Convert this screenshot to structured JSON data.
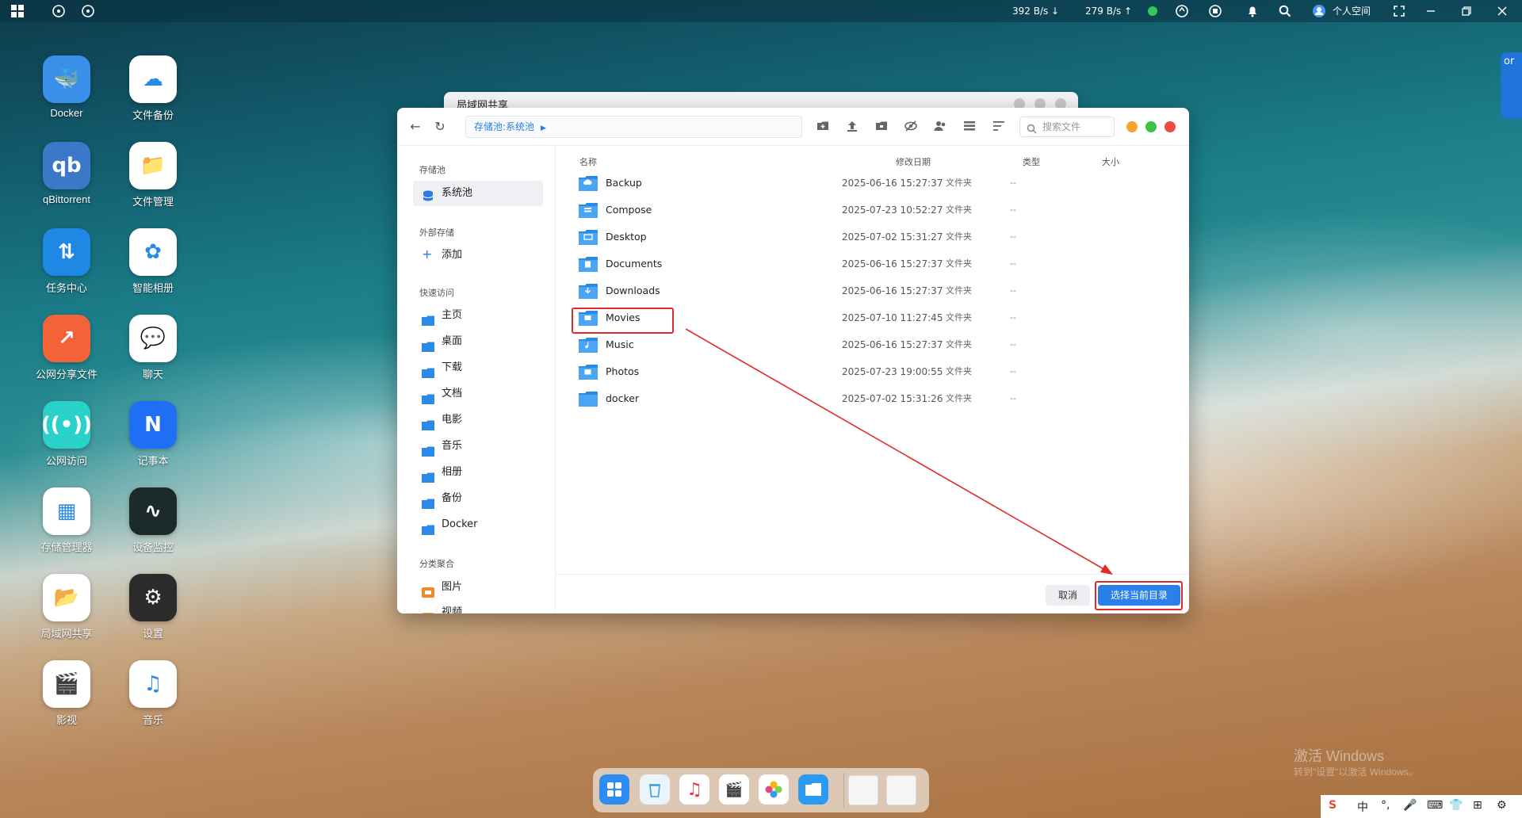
{
  "topbar": {
    "download_speed": "392 B/s ↓",
    "upload_speed": "279 B/s ↑",
    "user_label": "个人空间"
  },
  "desktop": {
    "icons": [
      {
        "label": "Docker",
        "color": "#3a8fe8",
        "glyph": "🐳"
      },
      {
        "label": "文件备份",
        "color": "#ffffff",
        "glyph": "☁"
      },
      {
        "label": "qBittorrent",
        "color": "#3b78c8",
        "glyph": "qb"
      },
      {
        "label": "文件管理",
        "color": "#ffffff",
        "glyph": "📁"
      },
      {
        "label": "任务中心",
        "color": "#1e88e5",
        "glyph": "⇅"
      },
      {
        "label": "智能相册",
        "color": "#ffffff",
        "glyph": "✿"
      },
      {
        "label": "公网分享文件",
        "color": "#f4623a",
        "glyph": "↗"
      },
      {
        "label": "聊天",
        "color": "#ffffff",
        "glyph": "💬"
      },
      {
        "label": "公网访问",
        "color": "#2ad1c9",
        "glyph": "((•))"
      },
      {
        "label": "记事本",
        "color": "#1e6ff5",
        "glyph": "N"
      },
      {
        "label": "存储管理器",
        "color": "#ffffff",
        "glyph": "▦"
      },
      {
        "label": "设备监控",
        "color": "#1d2a2a",
        "glyph": "∿"
      },
      {
        "label": "局域网共享",
        "color": "#ffffff",
        "glyph": "📂"
      },
      {
        "label": "设置",
        "color": "#2b2b2b",
        "glyph": "⚙"
      },
      {
        "label": "影视",
        "color": "#ffffff",
        "glyph": "🎬"
      },
      {
        "label": "音乐",
        "color": "#ffffff",
        "glyph": "♫"
      }
    ]
  },
  "bg_window": {
    "title": "局域网共享"
  },
  "dialog": {
    "path": "存储池:系统池",
    "search_placeholder": "搜索文件",
    "sidebar": {
      "storage_section": "存储池",
      "storage_item": "系统池",
      "external_section": "外部存储",
      "add_label": "添加",
      "quick_section": "快速访问",
      "quick_items": [
        "主页",
        "桌面",
        "下载",
        "文档",
        "电影",
        "音乐",
        "相册",
        "备份",
        "Docker"
      ],
      "category_section": "分类聚合",
      "category_items": [
        "图片",
        "视频"
      ]
    },
    "columns": {
      "name": "名称",
      "modified": "修改日期",
      "type": "类型",
      "size": "大小"
    },
    "files": [
      {
        "name": "Backup",
        "modified": "2025-06-16 15:27:37",
        "type": "文件夹",
        "size": "--"
      },
      {
        "name": "Compose",
        "modified": "2025-07-23 10:52:27",
        "type": "文件夹",
        "size": "--"
      },
      {
        "name": "Desktop",
        "modified": "2025-07-02 15:31:27",
        "type": "文件夹",
        "size": "--"
      },
      {
        "name": "Documents",
        "modified": "2025-06-16 15:27:37",
        "type": "文件夹",
        "size": "--"
      },
      {
        "name": "Downloads",
        "modified": "2025-06-16 15:27:37",
        "type": "文件夹",
        "size": "--"
      },
      {
        "name": "Movies",
        "modified": "2025-07-10 11:27:45",
        "type": "文件夹",
        "size": "--"
      },
      {
        "name": "Music",
        "modified": "2025-06-16 15:27:37",
        "type": "文件夹",
        "size": "--"
      },
      {
        "name": "Photos",
        "modified": "2025-07-23 19:00:55",
        "type": "文件夹",
        "size": "--"
      },
      {
        "name": "docker",
        "modified": "2025-07-02 15:31:26",
        "type": "文件夹",
        "size": "--"
      }
    ],
    "cancel_label": "取消",
    "confirm_label": "选择当前目录"
  },
  "watermark": {
    "line1": "激活 Windows",
    "line2": "转到\"设置\"以激活 Windows。"
  },
  "tray": {
    "ime": "中"
  },
  "right_edge_text": "or"
}
